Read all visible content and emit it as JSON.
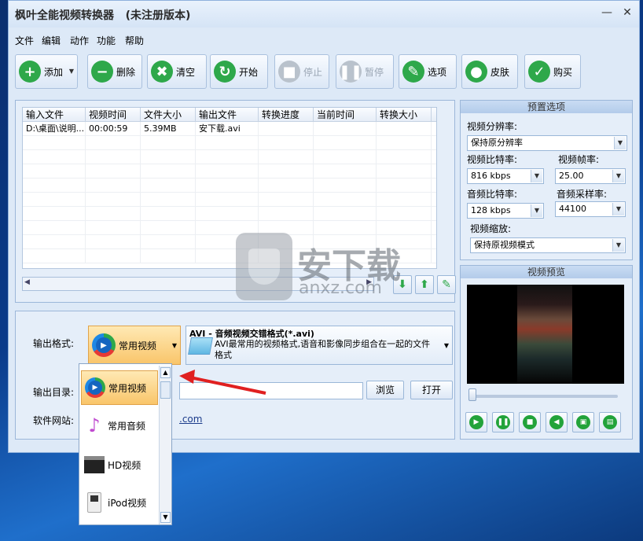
{
  "window": {
    "title": "枫叶全能视频转换器   (未注册版本)",
    "min": "—",
    "close": "✕"
  },
  "menu": [
    "文件",
    "编辑",
    "动作",
    "功能",
    "帮助"
  ],
  "toolbar": [
    {
      "label": "添加",
      "icon": "plus-icon",
      "color": "#2ea84a",
      "glyph": "+",
      "enabled": true,
      "dropdown": "▼"
    },
    {
      "label": "删除",
      "icon": "minus-icon",
      "color": "#2ea84a",
      "glyph": "−",
      "enabled": true
    },
    {
      "label": "清空",
      "icon": "clear-icon",
      "color": "#2ea84a",
      "glyph": "✖",
      "enabled": true
    },
    {
      "label": "开始",
      "icon": "start-icon",
      "color": "#2ea84a",
      "glyph": "↻",
      "enabled": true
    },
    {
      "label": "停止",
      "icon": "stop-icon",
      "color": "#b9c2cc",
      "glyph": "■",
      "enabled": false
    },
    {
      "label": "暂停",
      "icon": "pause-icon",
      "color": "#b9c2cc",
      "glyph": "❚❚",
      "enabled": false
    },
    {
      "label": "选项",
      "icon": "tools-icon",
      "color": "#2ea84a",
      "glyph": "✎",
      "enabled": true
    },
    {
      "label": "皮肤",
      "icon": "apple-icon",
      "color": "#2ea84a",
      "glyph": "●",
      "enabled": true
    },
    {
      "label": "购买",
      "icon": "cart-icon",
      "color": "#2ea84a",
      "glyph": "✓",
      "enabled": true
    }
  ],
  "grid": {
    "columns": [
      "输入文件",
      "视频时间",
      "文件大小",
      "输出文件",
      "转换进度",
      "当前时间",
      "转换大小"
    ],
    "rows": [
      [
        "D:\\桌面\\说明...",
        "00:00:59",
        "5.39MB",
        "安下载.avi",
        "",
        "",
        ""
      ]
    ]
  },
  "format": {
    "output_format_label": "输出格式:",
    "selected": "常用视频",
    "desc_title": "AVI - 音频视频交错格式(*.avi)",
    "desc_text": "AVI最常用的视频格式,语音和影像同步组合在一起的文件格式",
    "output_dir_label": "输出目录:",
    "browse": "浏览",
    "open": "打开",
    "website_label": "软件网站:",
    "website_value": ".com"
  },
  "dropdown_items": [
    "常用视频",
    "常用音频",
    "HD视频",
    "iPod视频"
  ],
  "preset": {
    "title": "预置选项",
    "res_label": "视频分辨率:",
    "res_value": "保持原分辨率",
    "vbit_label": "视频比特率:",
    "vbit_value": "816 kbps",
    "fps_label": "视频帧率:",
    "fps_value": "25.00",
    "abit_label": "音频比特率:",
    "abit_value": "128 kbps",
    "asr_label": "音频采样率:",
    "asr_value": "44100",
    "scale_label": "视频缩放:",
    "scale_value": "保持原视频模式"
  },
  "preview": {
    "title": "视频预览"
  },
  "watermark": {
    "text": "安下载",
    "sub": "anxz.com"
  },
  "colors": {
    "accent": "#2ea84a",
    "arrow": "#e02020"
  }
}
